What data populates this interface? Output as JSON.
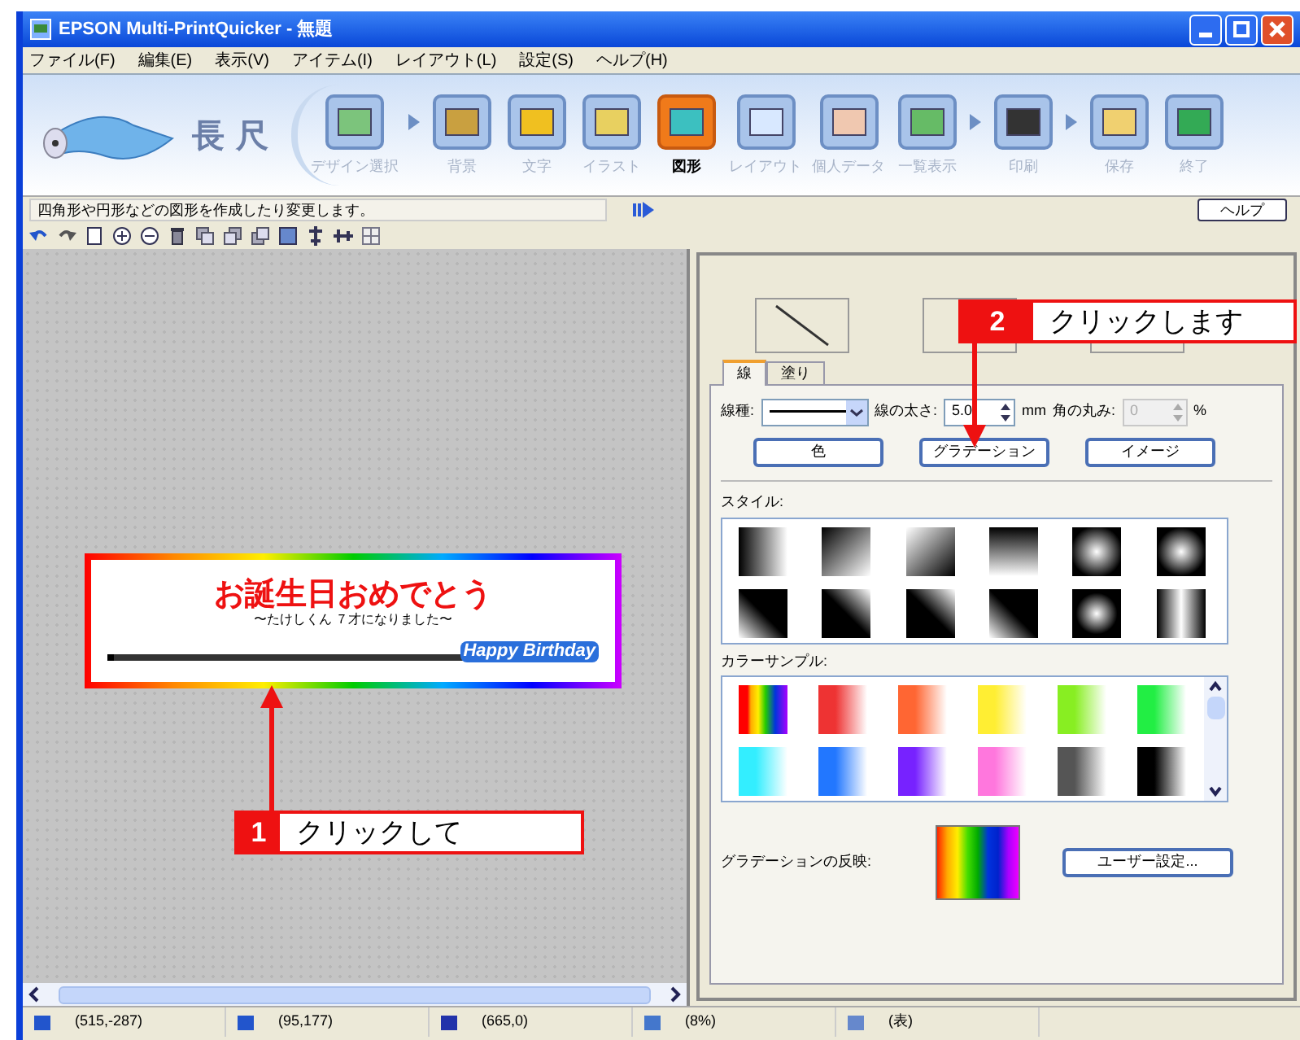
{
  "window": {
    "title": "EPSON Multi-PrintQuicker - 無題"
  },
  "menu": [
    "ファイル(F)",
    "編集(E)",
    "表示(V)",
    "アイテム(I)",
    "レイアウト(L)",
    "設定(S)",
    "ヘルプ(H)"
  ],
  "logo": {
    "text": "長 尺"
  },
  "steps": [
    {
      "label": "デザイン選択",
      "selected": false,
      "arrow_after": true
    },
    {
      "label": "背景",
      "selected": false,
      "arrow_after": false
    },
    {
      "label": "文字",
      "selected": false,
      "arrow_after": false
    },
    {
      "label": "イラスト",
      "selected": false,
      "arrow_after": false
    },
    {
      "label": "図形",
      "selected": true,
      "arrow_after": false
    },
    {
      "label": "レイアウト",
      "selected": false,
      "arrow_after": false
    },
    {
      "label": "個人データ",
      "selected": false,
      "arrow_after": false
    },
    {
      "label": "一覧表示",
      "selected": false,
      "arrow_after": true
    },
    {
      "label": "印刷",
      "selected": false,
      "arrow_after": true
    },
    {
      "label": "保存",
      "selected": false,
      "arrow_after": false
    },
    {
      "label": "終了",
      "selected": false,
      "arrow_after": false
    }
  ],
  "hint": {
    "text": "四角形や円形などの図形を作成したり変更します。",
    "help_button": "ヘルプ"
  },
  "canvas": {
    "title": "お誕生日おめでとう",
    "subtitle": "〜たけしくん ７才になりました〜",
    "tag": "Happy Birthday"
  },
  "panel": {
    "tabs": [
      {
        "label": "線",
        "selected": true
      },
      {
        "label": "塗り",
        "selected": false
      }
    ],
    "line_type_label": "線種:",
    "thickness": {
      "label": "線の太さ:",
      "value": "5.0",
      "unit": "mm",
      "disabled": false
    },
    "corner": {
      "label": "角の丸み:",
      "value": "0",
      "unit": "%",
      "disabled": true
    },
    "buttons": [
      "色",
      "グラデーション",
      "イメージ"
    ],
    "style_label": "スタイル:",
    "color_label": "カラーサンプル:",
    "color_samples": [
      {
        "kind": "rainbow",
        "color": "#ff0000"
      },
      {
        "kind": "solid",
        "color": "#ee3333"
      },
      {
        "kind": "solid",
        "color": "#ff6633"
      },
      {
        "kind": "solid",
        "color": "#ffee33"
      },
      {
        "kind": "solid",
        "color": "#88ee22"
      },
      {
        "kind": "solid",
        "color": "#22ee44"
      },
      {
        "kind": "solid",
        "color": "#33eeff"
      },
      {
        "kind": "solid",
        "color": "#2277ff"
      },
      {
        "kind": "solid",
        "color": "#7722ff"
      },
      {
        "kind": "solid",
        "color": "#ff77dd"
      },
      {
        "kind": "solid",
        "color": "#555555"
      },
      {
        "kind": "solid",
        "color": "#000000"
      }
    ],
    "apply_label": "グラデーションの反映:",
    "user_button": "ユーザー設定..."
  },
  "callouts": [
    {
      "number": "1",
      "text": "クリックして"
    },
    {
      "number": "2",
      "text": "クリックします"
    }
  ],
  "status_bar": [
    "(515,-287)",
    "(95,177)",
    "(665,0)",
    "(8%)",
    "(表)"
  ]
}
